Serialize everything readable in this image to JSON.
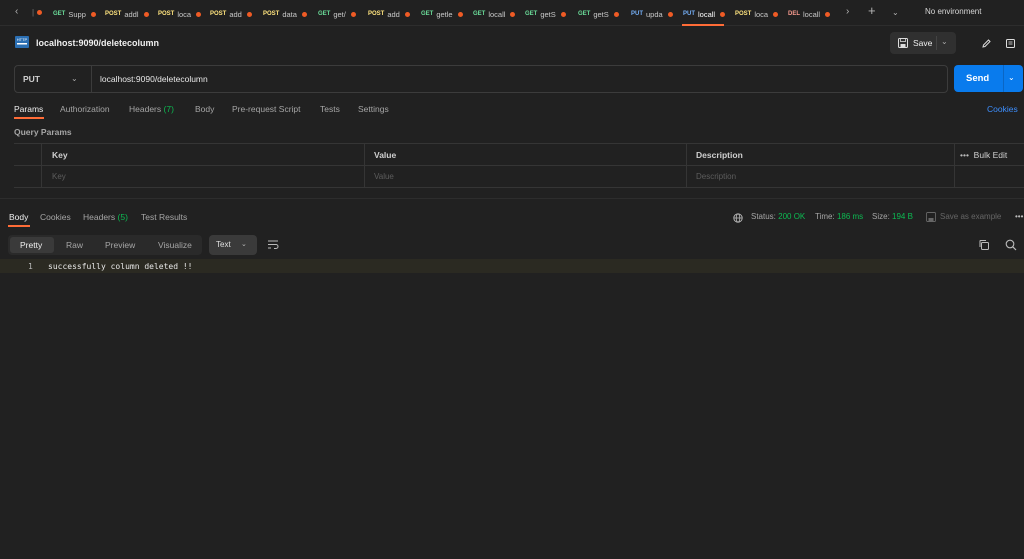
{
  "tabs": [
    {
      "method": "GET",
      "title": "Supp",
      "color": "#6bdd9a"
    },
    {
      "method": "POST",
      "title": "addl",
      "color": "#ffe47e"
    },
    {
      "method": "POST",
      "title": "loca",
      "color": "#ffe47e"
    },
    {
      "method": "POST",
      "title": "add",
      "color": "#ffe47e"
    },
    {
      "method": "POST",
      "title": "data",
      "color": "#ffe47e"
    },
    {
      "method": "GET",
      "title": "get/",
      "color": "#6bdd9a"
    },
    {
      "method": "POST",
      "title": "add",
      "color": "#ffe47e"
    },
    {
      "method": "GET",
      "title": "getle",
      "color": "#6bdd9a"
    },
    {
      "method": "GET",
      "title": "locall",
      "color": "#6bdd9a"
    },
    {
      "method": "GET",
      "title": "getS",
      "color": "#6bdd9a"
    },
    {
      "method": "GET",
      "title": "getS",
      "color": "#6bdd9a"
    },
    {
      "method": "PUT",
      "title": "upda",
      "color": "#74aef6"
    },
    {
      "method": "PUT",
      "title": "locall",
      "color": "#74aef6"
    },
    {
      "method": "POST",
      "title": "loca",
      "color": "#ffe47e"
    },
    {
      "method": "DEL",
      "title": "locall",
      "color": "#f79a8e"
    }
  ],
  "environment": "No environment",
  "request": {
    "title": "localhost:9090/deletecolumn",
    "method": "PUT",
    "url": "localhost:9090/deletecolumn",
    "save_label": "Save",
    "send_label": "Send"
  },
  "request_tabs": {
    "params": "Params",
    "authorization": "Authorization",
    "headers": "Headers",
    "headers_count": "(7)",
    "body": "Body",
    "prerequest": "Pre-request Script",
    "tests": "Tests",
    "settings": "Settings",
    "cookies": "Cookies"
  },
  "query_params": {
    "label": "Query Params",
    "col_key": "Key",
    "col_value": "Value",
    "col_description": "Description",
    "bulk_edit": "Bulk Edit",
    "ph_key": "Key",
    "ph_value": "Value",
    "ph_description": "Description"
  },
  "response": {
    "tabs": {
      "body": "Body",
      "cookies": "Cookies",
      "headers": "Headers",
      "headers_count": "(5)",
      "test_results": "Test Results"
    },
    "status_label": "Status:",
    "status_value": "200 OK",
    "time_label": "Time:",
    "time_value": "186 ms",
    "size_label": "Size:",
    "size_value": "194 B",
    "save_example": "Save as example",
    "formats": {
      "pretty": "Pretty",
      "raw": "Raw",
      "preview": "Preview",
      "visualize": "Visualize",
      "type": "Text"
    },
    "line_number": "1",
    "body_text": "successfully column deleted !!"
  }
}
